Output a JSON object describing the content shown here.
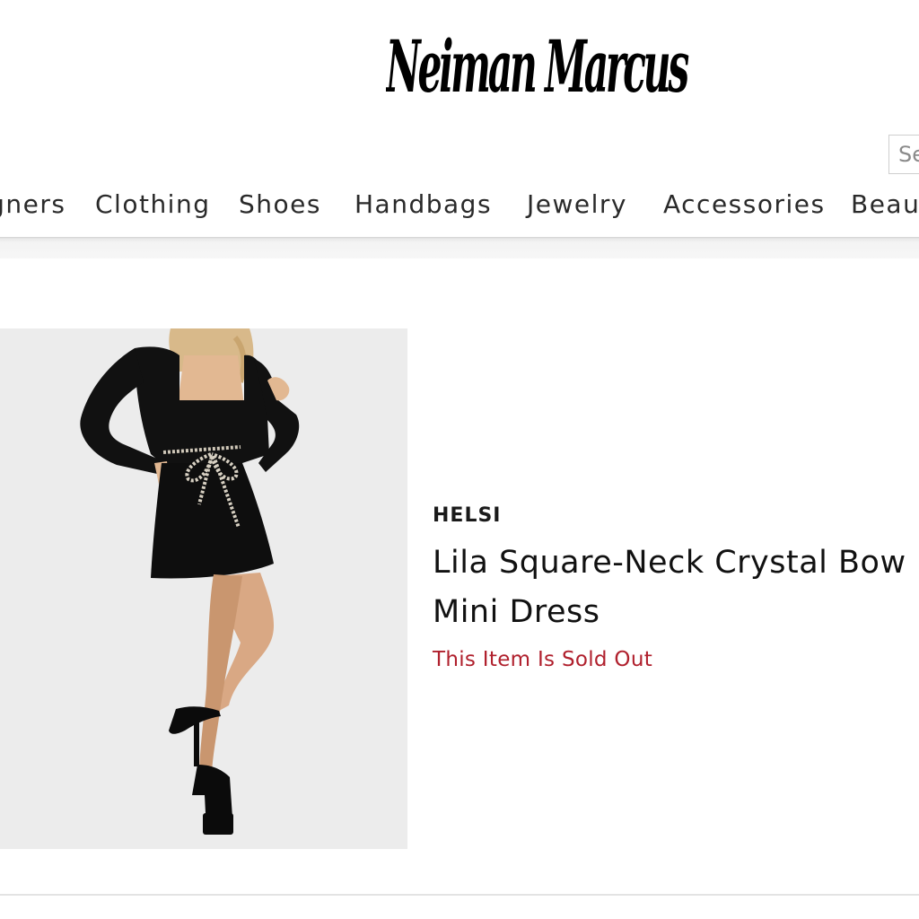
{
  "header": {
    "logo_text": "Neiman Marcus",
    "search": {
      "placeholder": "Search"
    }
  },
  "nav": {
    "items": [
      {
        "label": "Designers"
      },
      {
        "label": "Clothing"
      },
      {
        "label": "Shoes"
      },
      {
        "label": "Handbags"
      },
      {
        "label": "Jewelry"
      },
      {
        "label": "Accessories"
      },
      {
        "label": "Beauty"
      }
    ]
  },
  "product": {
    "brand": "HELSI",
    "title": "Lila Square-Neck Crystal Bow Mini Dress",
    "status": "This Item Is Sold Out",
    "image_alt": "Model wearing black square-neck mini dress with crystal bow belt",
    "status_color": "#b0202d"
  }
}
